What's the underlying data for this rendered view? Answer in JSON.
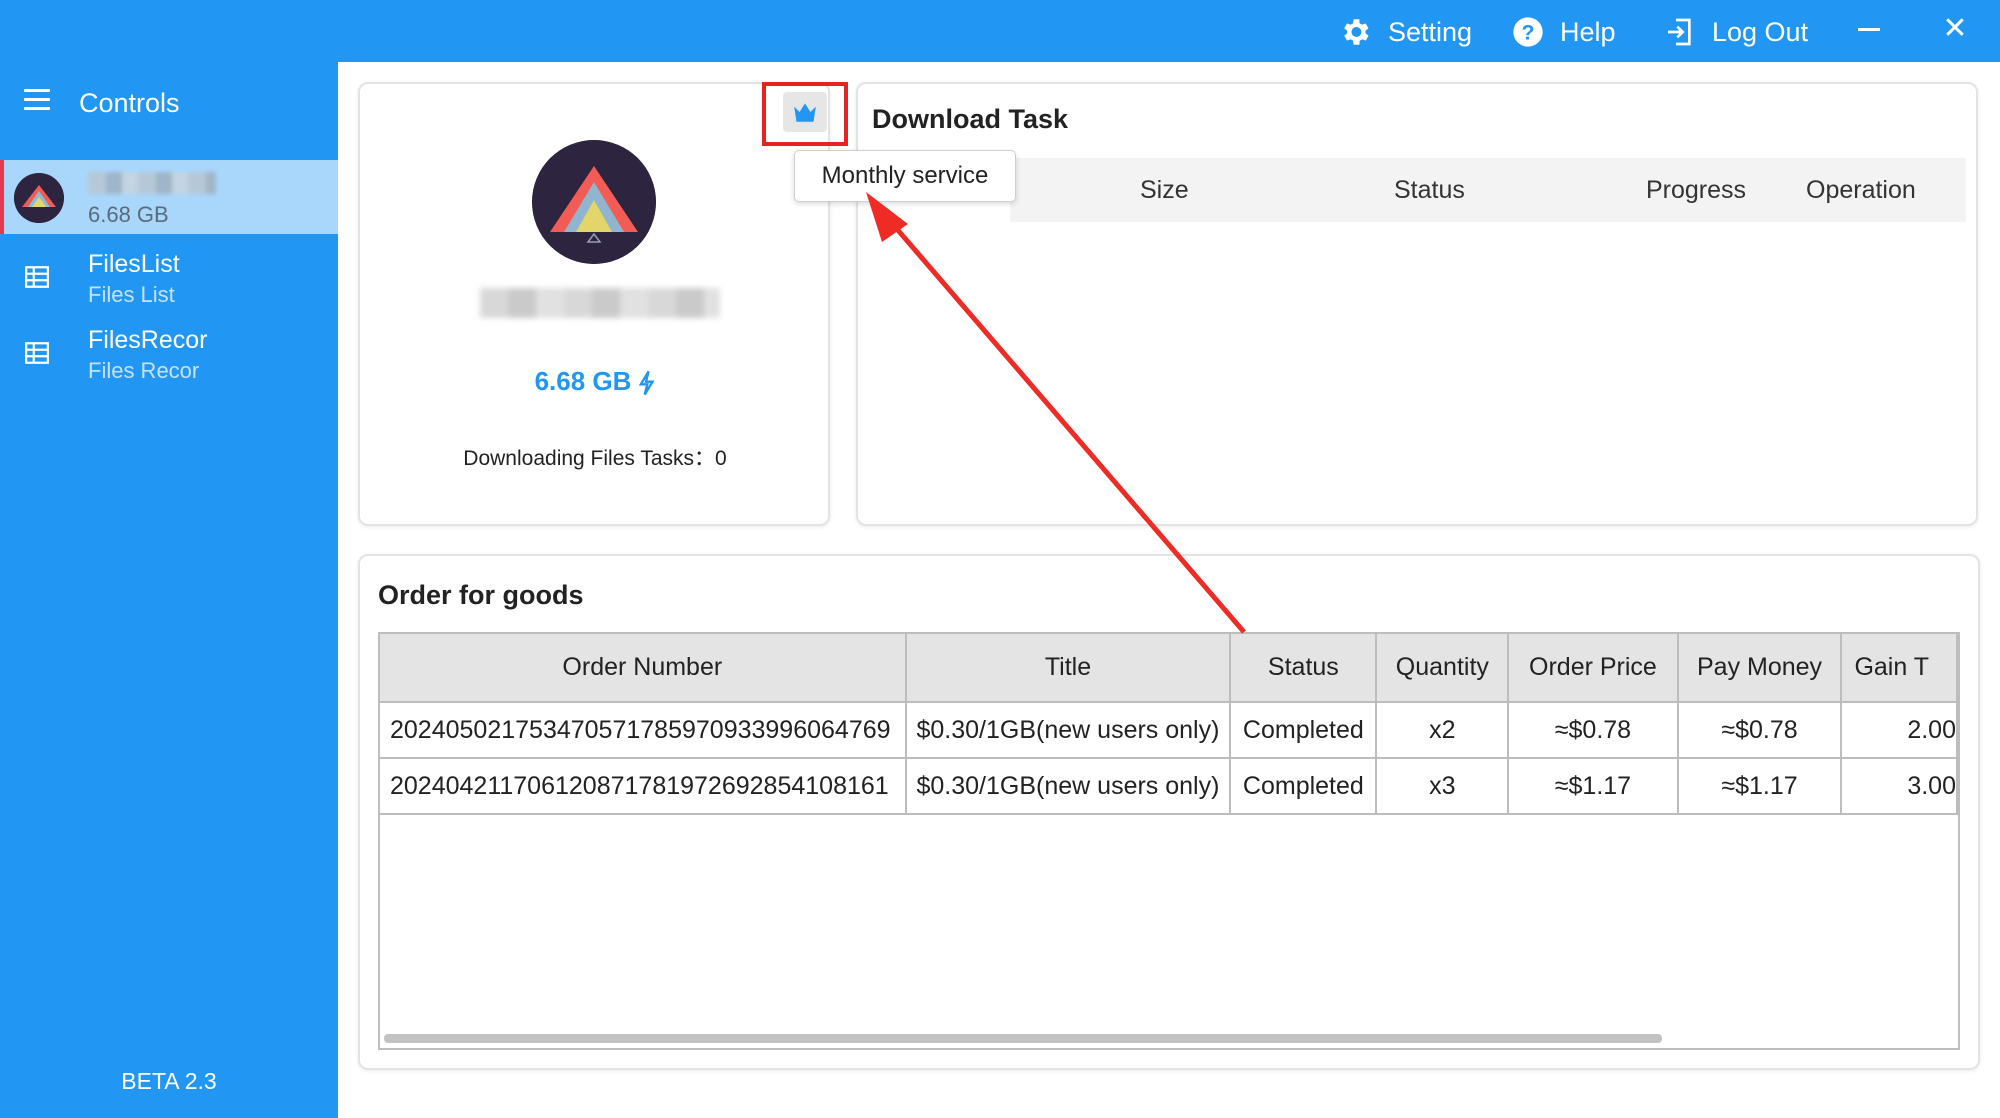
{
  "titlebar": {
    "setting_label": "Setting",
    "help_label": "Help",
    "logout_label": "Log Out",
    "close_glyph": "✕",
    "color": "#2196f3"
  },
  "sidebar": {
    "title": "Controls",
    "user": {
      "storage": "6.68 GB"
    },
    "items": [
      {
        "label": "FilesList",
        "sublabel": "Files List",
        "icon": "grid-icon"
      },
      {
        "label": "FilesRecor",
        "sublabel": "Files Recor",
        "icon": "grid-icon"
      }
    ],
    "version": "BETA 2.3"
  },
  "profile": {
    "storage": "6.68 GB",
    "downloading_tasks": "Downloading Files Tasks：0",
    "crown_icon": "crown-icon",
    "tooltip": "Monthly service"
  },
  "download_task": {
    "title": "Download Task",
    "columns": [
      "Size",
      "Status",
      "Progress",
      "Operation"
    ]
  },
  "orders": {
    "title": "Order for goods",
    "columns": [
      "Order Number",
      "Title",
      "Status",
      "Quantity",
      "Order Price",
      "Pay Money",
      "Gain T"
    ],
    "rows": [
      [
        "20240502175347057178597093399606476​9",
        "$0.30/1GB(new users only)",
        "Completed",
        "x2",
        "≈$0.78",
        "≈$0.78",
        "2.00"
      ],
      [
        "20240421170612087178197269285410816​1",
        "$0.30/1GB(new users only)",
        "Completed",
        "x3",
        "≈$1.17",
        "≈$1.17",
        "3.00"
      ]
    ]
  },
  "colors": {
    "accent": "#2196f3",
    "highlight": "#e8231d",
    "active_bg": "#a9d6fb"
  }
}
